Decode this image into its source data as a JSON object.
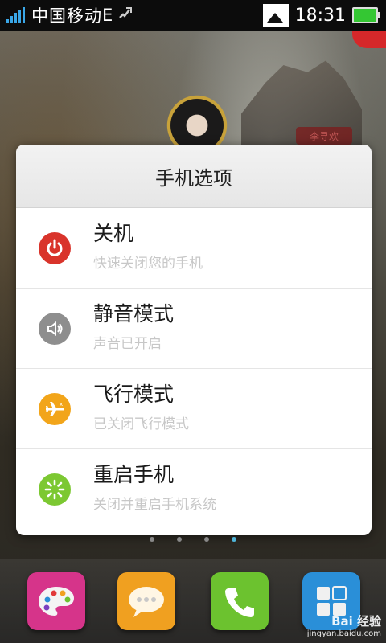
{
  "status_bar": {
    "carrier": "中国移动",
    "network_type": "E",
    "time": "18:31",
    "signal_color": "#3aa7e8",
    "battery_color": "#34c733",
    "icons": [
      "signal-icon",
      "data-phone-icon",
      "image-notification-icon",
      "battery-icon"
    ]
  },
  "wallpaper": {
    "tag_text": "李寻欢"
  },
  "dialog": {
    "title": "手机选项",
    "options": [
      {
        "title": "关机",
        "subtitle": "快速关闭您的手机",
        "icon": "power-icon",
        "color": "#d9342b"
      },
      {
        "title": "静音模式",
        "subtitle": "声音已开启",
        "icon": "speaker-icon",
        "color": "#8e8e8e"
      },
      {
        "title": "飞行模式",
        "subtitle": "已关闭飞行模式",
        "icon": "airplane-icon",
        "color": "#f2a51a"
      },
      {
        "title": "重启手机",
        "subtitle": "关闭并重启手机系统",
        "icon": "restart-icon",
        "color": "#7cc832"
      }
    ]
  },
  "pager": {
    "count": 4,
    "active_index": 3
  },
  "dock": {
    "apps": [
      {
        "name": "theme-app",
        "icon": "palette-icon",
        "color": "#d6348a"
      },
      {
        "name": "messages-app",
        "icon": "chat-bubble-icon",
        "color": "#f0a020"
      },
      {
        "name": "phone-app",
        "icon": "phone-icon",
        "color": "#6cc22f"
      },
      {
        "name": "apps-app",
        "icon": "grid-icon",
        "color": "#2a8fd8"
      }
    ]
  },
  "watermark": {
    "main": "Bai 经验",
    "sub": "jingyan.baidu.com"
  }
}
